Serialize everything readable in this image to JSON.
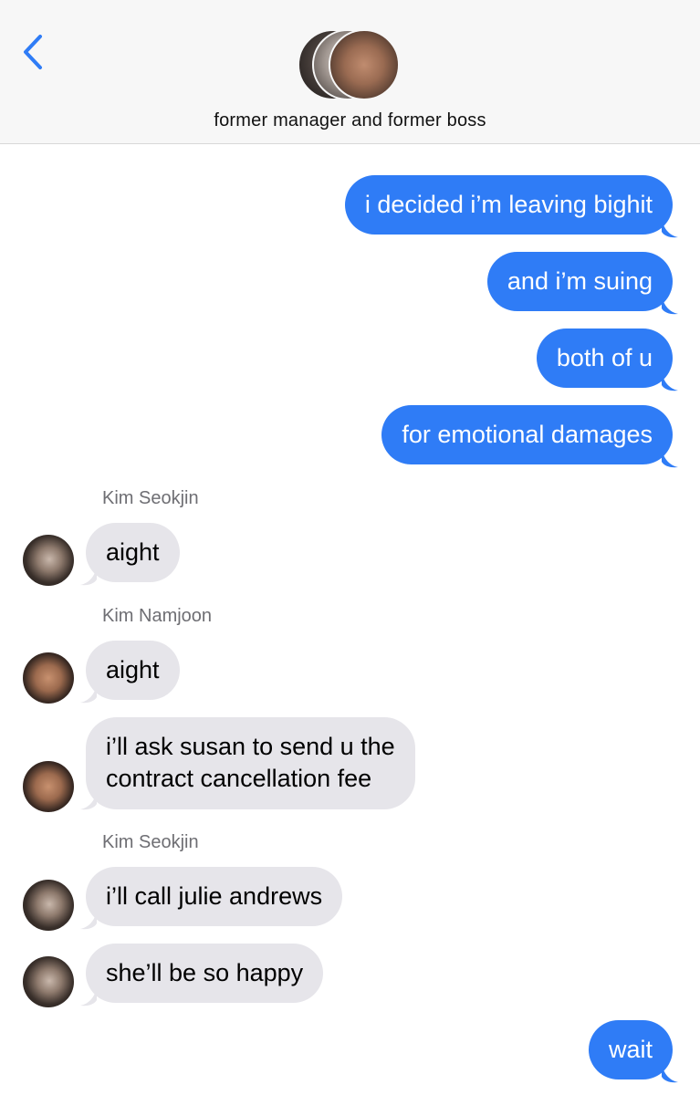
{
  "header": {
    "title": "former manager and former boss"
  },
  "messages": [
    {
      "side": "out",
      "text": "i decided i’m leaving bighit"
    },
    {
      "side": "out",
      "text": "and i’m suing"
    },
    {
      "side": "out",
      "text": "both of u"
    },
    {
      "side": "out",
      "text": "for emotional damages"
    },
    {
      "sender": "Kim Seokjin"
    },
    {
      "side": "in",
      "text": "aight"
    },
    {
      "sender": "Kim Namjoon"
    },
    {
      "side": "in",
      "text": "aight"
    },
    {
      "side": "in",
      "lines": [
        "i’ll ask susan to send u the",
        "contract cancellation fee"
      ]
    },
    {
      "sender": "Kim Seokjin"
    },
    {
      "side": "in",
      "text": "i’ll call julie andrews"
    },
    {
      "side": "in",
      "text": "she’ll be so happy"
    },
    {
      "side": "out",
      "text": "wait"
    }
  ],
  "colors": {
    "outgoing_bubble": "#2f7cf6",
    "incoming_bubble": "#e6e5ea",
    "back_chevron": "#2f7cf6"
  }
}
